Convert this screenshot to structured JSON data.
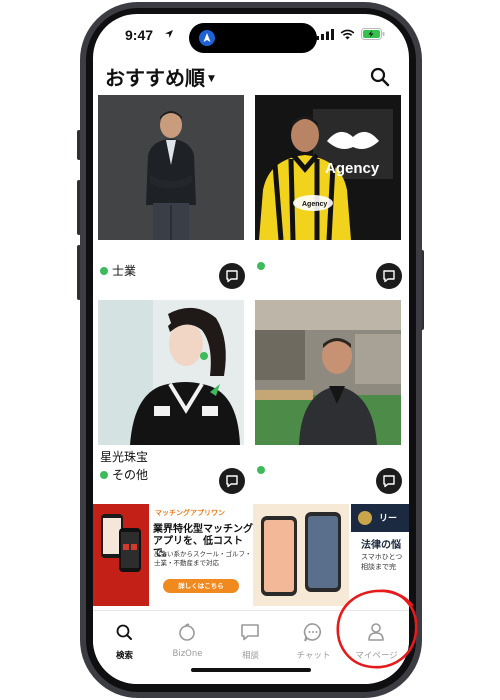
{
  "status_bar": {
    "time": "9:47"
  },
  "header": {
    "title": "おすすめ順"
  },
  "profiles": [
    {
      "name": "",
      "category": "士業"
    },
    {
      "name": "",
      "category": ""
    },
    {
      "name": "星光珠宝",
      "category": "その他"
    },
    {
      "name": "",
      "category": ""
    }
  ],
  "card2_logo_text": "Agency",
  "banner": {
    "brand": "マッチングアプリワン",
    "headline": "業界特化型マッチングアプリを、低コストで。",
    "subtext": "出会い系からスクール・ゴルフ・士業・不動産まで対応",
    "cta": "詳しくはこちら",
    "right_title": "法律の悩",
    "right_sub": "スマホひとつ\n相談まで完",
    "right_badge": "リー"
  },
  "tabs": [
    {
      "label": "検索",
      "icon": "search-icon",
      "active": true
    },
    {
      "label": "BizOne",
      "icon": "bizone-icon",
      "active": false
    },
    {
      "label": "相談",
      "icon": "consult-icon",
      "active": false
    },
    {
      "label": "チャット",
      "icon": "chat-icon",
      "active": false
    },
    {
      "label": "マイページ",
      "icon": "person-icon",
      "active": false
    }
  ],
  "colors": {
    "online_dot": "#3dbb5b",
    "annotation_circle": "#e51b1b",
    "cta": "#f08a1f"
  }
}
